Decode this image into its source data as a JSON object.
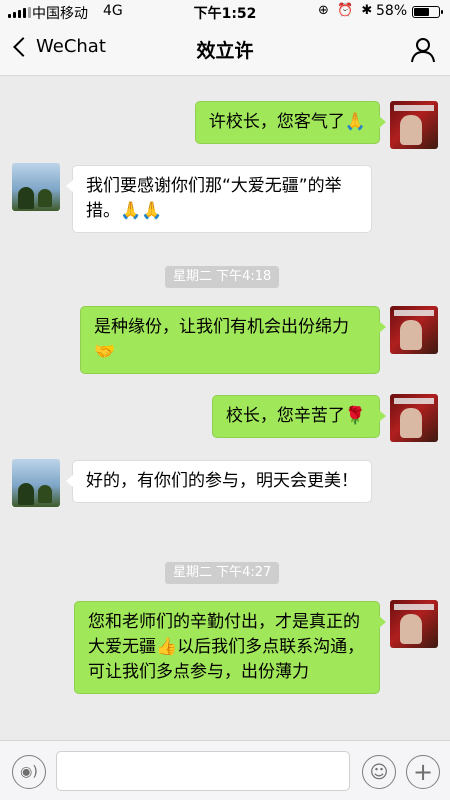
{
  "status_bar": {
    "carrier": "中国移动",
    "network": "4G",
    "time": "下午1:52",
    "icons": "⊕ ⏰ ✱",
    "battery": "58%",
    "battery_level": 0.58
  },
  "nav": {
    "back_label": "WeChat",
    "title": "效立许"
  },
  "messages": [
    {
      "side": "out",
      "text": "许校长，您客气了🙏"
    },
    {
      "side": "in",
      "text": "我们要感谢你们那“大爱无疆”的举措。🙏🙏"
    },
    {
      "type": "time",
      "text": "星期二 下午4:18"
    },
    {
      "side": "out",
      "text": "是种缘份，让我们有机会出份绵力🤝"
    },
    {
      "side": "out",
      "text": "校长，您辛苦了🌹"
    },
    {
      "side": "in",
      "text": "好的，有你们的参与，明天会更美！"
    },
    {
      "type": "time",
      "text": "星期二 下午4:27"
    },
    {
      "side": "out",
      "text": "您和老师们的辛勤付出，才是真正的大爱无疆👍以后我们多点联系沟通，可让我们多点参与，出份薄力"
    }
  ],
  "input": {
    "placeholder": "",
    "voice_icon": "voice-icon",
    "emoji_icon": "emoji-icon",
    "plus_icon": "plus-icon"
  },
  "colors": {
    "outgoing_bubble": "#a0e75a",
    "incoming_bubble": "#ffffff",
    "background": "#ebebeb"
  }
}
